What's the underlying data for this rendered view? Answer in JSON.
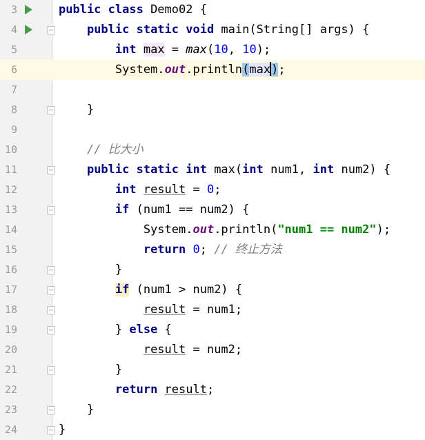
{
  "editor": {
    "lines": [
      {
        "n": "3",
        "tokens": [
          {
            "t": "public class ",
            "c": "kw"
          },
          {
            "t": "Demo02 {",
            "c": ""
          }
        ]
      },
      {
        "n": "4",
        "tokens": [
          {
            "t": "    "
          },
          {
            "t": "public static void ",
            "c": "kw"
          },
          {
            "t": "main(String[] args) {",
            "c": ""
          }
        ]
      },
      {
        "n": "5",
        "tokens": [
          {
            "t": "        "
          },
          {
            "t": "int ",
            "c": "kw"
          },
          {
            "t": "max",
            "c": "hlvar"
          },
          {
            "t": " = "
          },
          {
            "t": "max",
            "c": "callit"
          },
          {
            "t": "("
          },
          {
            "t": "10",
            "c": "num"
          },
          {
            "t": ", "
          },
          {
            "t": "10",
            "c": "num"
          },
          {
            "t": ");"
          }
        ]
      },
      {
        "n": "6",
        "tokens": [
          {
            "t": "        System."
          },
          {
            "t": "out",
            "c": "fld"
          },
          {
            "t": ".println"
          },
          {
            "t": "(",
            "c": "brace"
          },
          {
            "t": "max",
            "c": "hlread"
          },
          {
            "t": "|",
            "c": "caret"
          },
          {
            "t": ")",
            "c": "brace"
          },
          {
            "t": ";"
          }
        ]
      },
      {
        "n": "7",
        "tokens": []
      },
      {
        "n": "8",
        "tokens": [
          {
            "t": "    }"
          }
        ]
      },
      {
        "n": "9",
        "tokens": []
      },
      {
        "n": "10",
        "tokens": [
          {
            "t": "    "
          },
          {
            "t": "// 比大小",
            "c": "cmt"
          }
        ]
      },
      {
        "n": "11",
        "tokens": [
          {
            "t": "    "
          },
          {
            "t": "public static int ",
            "c": "kw"
          },
          {
            "t": "max("
          },
          {
            "t": "int ",
            "c": "kw"
          },
          {
            "t": "num1, "
          },
          {
            "t": "int ",
            "c": "kw"
          },
          {
            "t": "num2) {"
          }
        ]
      },
      {
        "n": "12",
        "tokens": [
          {
            "t": "        "
          },
          {
            "t": "int ",
            "c": "kw"
          },
          {
            "t": "result",
            "c": "uvar"
          },
          {
            "t": " = "
          },
          {
            "t": "0",
            "c": "num"
          },
          {
            "t": ";"
          }
        ]
      },
      {
        "n": "13",
        "tokens": [
          {
            "t": "        "
          },
          {
            "t": "if ",
            "c": "kw"
          },
          {
            "t": "(num1 == num2) {"
          }
        ]
      },
      {
        "n": "14",
        "tokens": [
          {
            "t": "            System."
          },
          {
            "t": "out",
            "c": "fld"
          },
          {
            "t": ".println("
          },
          {
            "t": "\"num1 == num2\"",
            "c": "str"
          },
          {
            "t": ");"
          }
        ]
      },
      {
        "n": "15",
        "tokens": [
          {
            "t": "            "
          },
          {
            "t": "return ",
            "c": "kw"
          },
          {
            "t": "0",
            "c": "num"
          },
          {
            "t": "; "
          },
          {
            "t": "// 终止方法",
            "c": "cmt"
          }
        ]
      },
      {
        "n": "16",
        "tokens": [
          {
            "t": "        }"
          }
        ]
      },
      {
        "n": "17",
        "tokens": [
          {
            "t": "        "
          },
          {
            "t": "if",
            "c": "kw ifhl"
          },
          {
            "t": " (num1 > num2) {"
          }
        ]
      },
      {
        "n": "18",
        "tokens": [
          {
            "t": "            "
          },
          {
            "t": "result",
            "c": "uvar"
          },
          {
            "t": " = num1;"
          }
        ]
      },
      {
        "n": "19",
        "tokens": [
          {
            "t": "        } "
          },
          {
            "t": "else ",
            "c": "kw"
          },
          {
            "t": "{"
          }
        ]
      },
      {
        "n": "20",
        "tokens": [
          {
            "t": "            "
          },
          {
            "t": "result",
            "c": "uvar"
          },
          {
            "t": " = num2;"
          }
        ]
      },
      {
        "n": "21",
        "tokens": [
          {
            "t": "        }"
          }
        ]
      },
      {
        "n": "22",
        "tokens": [
          {
            "t": "        "
          },
          {
            "t": "return ",
            "c": "kw"
          },
          {
            "t": "result",
            "c": "uvar"
          },
          {
            "t": ";"
          }
        ]
      },
      {
        "n": "23",
        "tokens": [
          {
            "t": "    }"
          }
        ]
      },
      {
        "n": "24",
        "tokens": [
          {
            "t": "}"
          }
        ]
      }
    ],
    "run_icons_on": [
      "3",
      "4"
    ],
    "fold_open_on": [
      "4",
      "11",
      "13",
      "17",
      "19"
    ],
    "fold_close_on": [
      "8",
      "16",
      "18",
      "21",
      "23",
      "24"
    ],
    "current_line": "6",
    "colors": {
      "keyword": "#000080",
      "number": "#0000ff",
      "string": "#008000",
      "comment": "#808080",
      "field": "#660e7a",
      "gutter": "#f2f2f2",
      "current_line": "#fffae3"
    }
  }
}
